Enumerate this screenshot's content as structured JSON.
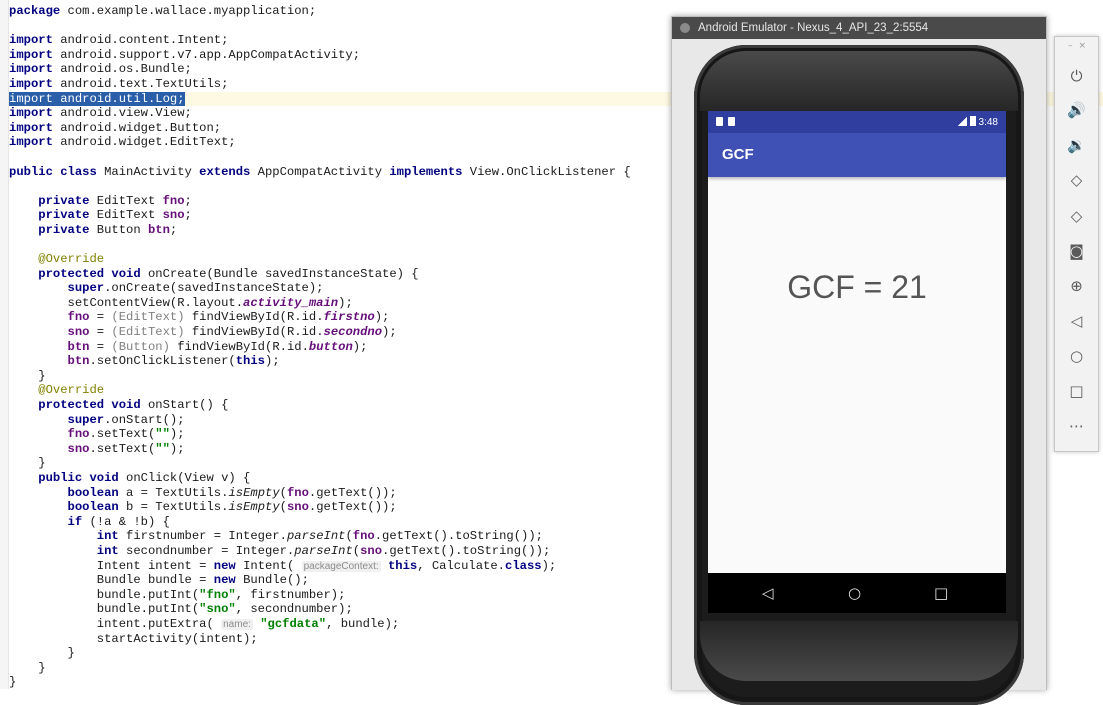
{
  "editor": {
    "lines": [
      [
        {
          "t": "package ",
          "c": "kw"
        },
        {
          "t": "com.example.wallace.myapplication;"
        }
      ],
      [],
      [
        {
          "t": "import ",
          "c": "kw"
        },
        {
          "t": "android.content.Intent;"
        }
      ],
      [
        {
          "t": "import ",
          "c": "kw"
        },
        {
          "t": "android.support.v7.app.AppCompatActivity;"
        }
      ],
      [
        {
          "t": "import ",
          "c": "kw"
        },
        {
          "t": "android.os.Bundle;"
        }
      ],
      [
        {
          "t": "import ",
          "c": "kw"
        },
        {
          "t": "android.text.TextUtils;"
        }
      ],
      [
        {
          "t": "import android.util.Log;",
          "c": "sel"
        }
      ],
      [
        {
          "t": "import ",
          "c": "kw"
        },
        {
          "t": "android.view.View;"
        }
      ],
      [
        {
          "t": "import ",
          "c": "kw"
        },
        {
          "t": "android.widget.Button;"
        }
      ],
      [
        {
          "t": "import ",
          "c": "kw"
        },
        {
          "t": "android.widget.EditText;"
        }
      ],
      [],
      [
        {
          "t": "public class ",
          "c": "kw"
        },
        {
          "t": "MainActivity "
        },
        {
          "t": "extends ",
          "c": "kw"
        },
        {
          "t": "AppCompatActivity "
        },
        {
          "t": "implements ",
          "c": "kw"
        },
        {
          "t": "View.OnClickListener {"
        }
      ],
      [],
      [
        {
          "t": "    private ",
          "c": "kw"
        },
        {
          "t": "EditText "
        },
        {
          "t": "fno",
          "c": "fld"
        },
        {
          "t": ";"
        }
      ],
      [
        {
          "t": "    private ",
          "c": "kw"
        },
        {
          "t": "EditText "
        },
        {
          "t": "sno",
          "c": "fld"
        },
        {
          "t": ";"
        }
      ],
      [
        {
          "t": "    private ",
          "c": "kw"
        },
        {
          "t": "Button "
        },
        {
          "t": "btn",
          "c": "fld"
        },
        {
          "t": ";"
        }
      ],
      [],
      [
        {
          "t": "    @Override",
          "c": "ann"
        }
      ],
      [
        {
          "t": "    protected void ",
          "c": "kw"
        },
        {
          "t": "onCreate(Bundle savedInstanceState) {"
        }
      ],
      [
        {
          "t": "        super",
          "c": "kw"
        },
        {
          "t": ".onCreate(savedInstanceState);"
        }
      ],
      [
        {
          "t": "        setContentView(R.layout."
        },
        {
          "t": "activity_main",
          "c": "itfld"
        },
        {
          "t": ");"
        }
      ],
      [
        {
          "t": "        fno",
          "c": "fld"
        },
        {
          "t": " = "
        },
        {
          "t": "(EditText)",
          "c": "cast"
        },
        {
          "t": " findViewById(R.id."
        },
        {
          "t": "firstno",
          "c": "itfld"
        },
        {
          "t": ");"
        }
      ],
      [
        {
          "t": "        sno",
          "c": "fld"
        },
        {
          "t": " = "
        },
        {
          "t": "(EditText)",
          "c": "cast"
        },
        {
          "t": " findViewById(R.id."
        },
        {
          "t": "secondno",
          "c": "itfld"
        },
        {
          "t": ");"
        }
      ],
      [
        {
          "t": "        btn",
          "c": "fld"
        },
        {
          "t": " = "
        },
        {
          "t": "(Button)",
          "c": "cast"
        },
        {
          "t": " findViewById(R.id."
        },
        {
          "t": "button",
          "c": "itfld"
        },
        {
          "t": ");"
        }
      ],
      [
        {
          "t": "        btn",
          "c": "fld"
        },
        {
          "t": ".setOnClickListener("
        },
        {
          "t": "this",
          "c": "kw"
        },
        {
          "t": ");"
        }
      ],
      [
        {
          "t": "    }"
        }
      ],
      [
        {
          "t": "    @Override",
          "c": "ann"
        }
      ],
      [
        {
          "t": "    protected void ",
          "c": "kw"
        },
        {
          "t": "onStart() {"
        }
      ],
      [
        {
          "t": "        super",
          "c": "kw"
        },
        {
          "t": ".onStart();"
        }
      ],
      [
        {
          "t": "        fno",
          "c": "fld"
        },
        {
          "t": ".setText("
        },
        {
          "t": "\"\"",
          "c": "str"
        },
        {
          "t": ");"
        }
      ],
      [
        {
          "t": "        sno",
          "c": "fld"
        },
        {
          "t": ".setText("
        },
        {
          "t": "\"\"",
          "c": "str"
        },
        {
          "t": ");"
        }
      ],
      [
        {
          "t": "    }"
        }
      ],
      [
        {
          "t": "    public void ",
          "c": "kw"
        },
        {
          "t": "onClick(View v) {"
        }
      ],
      [
        {
          "t": "        boolean ",
          "c": "kw"
        },
        {
          "t": "a = TextUtils."
        },
        {
          "t": "isEmpty",
          "c": "ital"
        },
        {
          "t": "("
        },
        {
          "t": "fno",
          "c": "fld"
        },
        {
          "t": ".getText());"
        }
      ],
      [
        {
          "t": "        boolean ",
          "c": "kw"
        },
        {
          "t": "b = TextUtils."
        },
        {
          "t": "isEmpty",
          "c": "ital"
        },
        {
          "t": "("
        },
        {
          "t": "sno",
          "c": "fld"
        },
        {
          "t": ".getText());"
        }
      ],
      [
        {
          "t": "        if ",
          "c": "kw"
        },
        {
          "t": "(!a & !b) {"
        }
      ],
      [
        {
          "t": "            int ",
          "c": "kw"
        },
        {
          "t": "firstnumber = Integer."
        },
        {
          "t": "parseInt",
          "c": "ital"
        },
        {
          "t": "("
        },
        {
          "t": "fno",
          "c": "fld"
        },
        {
          "t": ".getText().toString());"
        }
      ],
      [
        {
          "t": "            int ",
          "c": "kw"
        },
        {
          "t": "secondnumber = Integer."
        },
        {
          "t": "parseInt",
          "c": "ital"
        },
        {
          "t": "("
        },
        {
          "t": "sno",
          "c": "fld"
        },
        {
          "t": ".getText().toString());"
        }
      ],
      [
        {
          "t": "            Intent intent = "
        },
        {
          "t": "new ",
          "c": "kw"
        },
        {
          "t": "Intent( "
        },
        {
          "t": "packageContext:",
          "c": "hint"
        },
        {
          "t": " "
        },
        {
          "t": "this",
          "c": "kw"
        },
        {
          "t": ", Calculate."
        },
        {
          "t": "class",
          "c": "kw"
        },
        {
          "t": ");"
        }
      ],
      [
        {
          "t": "            Bundle bundle = "
        },
        {
          "t": "new ",
          "c": "kw"
        },
        {
          "t": "Bundle();"
        }
      ],
      [
        {
          "t": "            bundle.putInt("
        },
        {
          "t": "\"fno\"",
          "c": "str"
        },
        {
          "t": ", firstnumber);"
        }
      ],
      [
        {
          "t": "            bundle.putInt("
        },
        {
          "t": "\"sno\"",
          "c": "str"
        },
        {
          "t": ", secondnumber);"
        }
      ],
      [
        {
          "t": "            intent.putExtra( "
        },
        {
          "t": "name:",
          "c": "hint"
        },
        {
          "t": " "
        },
        {
          "t": "\"gcfdata\"",
          "c": "str"
        },
        {
          "t": ", bundle);"
        }
      ],
      [
        {
          "t": "            startActivity(intent);"
        }
      ],
      [
        {
          "t": "        }"
        }
      ],
      [
        {
          "t": "    }"
        }
      ],
      [
        {
          "t": "}"
        }
      ]
    ],
    "current_line": 6
  },
  "emulator": {
    "window_title": "Android Emulator - Nexus_4_API_23_2:5554",
    "status_time": "3:48",
    "app_title": "GCF",
    "result_text": "GCF = 21",
    "nav": {
      "back": "◁",
      "home": "○",
      "recents": "□"
    }
  },
  "toolbar": {
    "controls": [
      "–",
      "×"
    ],
    "buttons": [
      {
        "name": "power-icon",
        "glyph": "⏻"
      },
      {
        "name": "volume-up-icon",
        "glyph": "🔊"
      },
      {
        "name": "volume-down-icon",
        "glyph": "🔉"
      },
      {
        "name": "rotate-left-icon",
        "glyph": "◇"
      },
      {
        "name": "rotate-right-icon",
        "glyph": "◇"
      },
      {
        "name": "camera-icon",
        "glyph": "◙"
      },
      {
        "name": "zoom-icon",
        "glyph": "⊕"
      },
      {
        "name": "back-icon",
        "glyph": "◁"
      },
      {
        "name": "home-icon",
        "glyph": "○"
      },
      {
        "name": "overview-icon",
        "glyph": "□"
      },
      {
        "name": "more-icon",
        "glyph": "⋯"
      }
    ]
  }
}
